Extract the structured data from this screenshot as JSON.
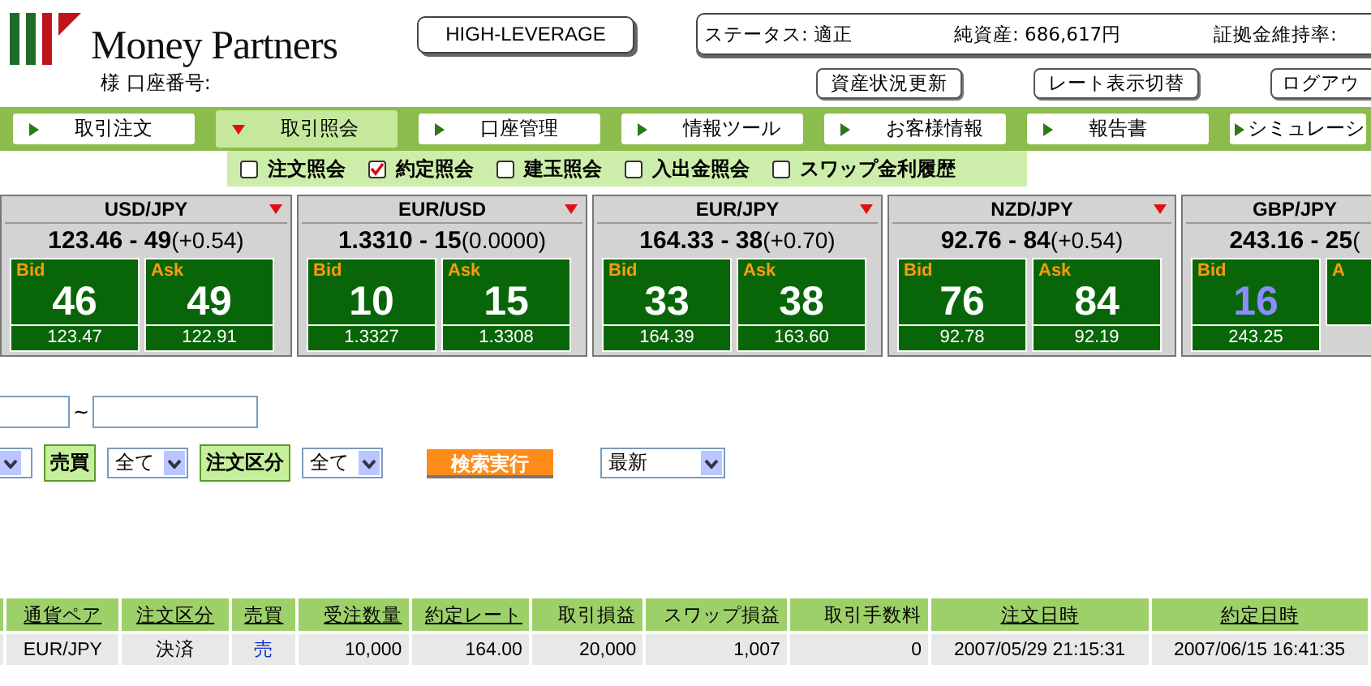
{
  "logo": {
    "name": "Money Partners"
  },
  "account": {
    "label": "様 口座番号:"
  },
  "mode_button": "HIGH-LEVERAGE",
  "status": [
    {
      "text": "ステータス: 適正"
    },
    {
      "text": "純資産: 686,617円"
    },
    {
      "text": "証拠金維持率:"
    }
  ],
  "header_buttons": [
    "資産状況更新",
    "レート表示切替",
    "ログアウ"
  ],
  "tabs": [
    {
      "label": "取引注文",
      "selected": false
    },
    {
      "label": "取引照会",
      "selected": true
    },
    {
      "label": "口座管理",
      "selected": false
    },
    {
      "label": "情報ツール",
      "selected": false
    },
    {
      "label": "お客様情報",
      "selected": false
    },
    {
      "label": "報告書",
      "selected": false
    },
    {
      "label": "シミュレーシ",
      "selected": false
    }
  ],
  "sub_menu": [
    {
      "label": "注文照会",
      "checked": false
    },
    {
      "label": "約定照会",
      "checked": true
    },
    {
      "label": "建玉照会",
      "checked": false
    },
    {
      "label": "入出金照会",
      "checked": false
    },
    {
      "label": "スワップ金利履歴",
      "checked": false
    }
  ],
  "quotes": [
    {
      "pair": "USD/JPY",
      "price": "123.46 - 49",
      "change": "(+0.54)",
      "bid": {
        "label": "Bid",
        "big": "46",
        "sub": "123.47",
        "updated": false
      },
      "ask": {
        "label": "Ask",
        "big": "49",
        "sub": "122.91",
        "updated": false
      }
    },
    {
      "pair": "EUR/USD",
      "price": "1.3310 - 15",
      "change": "(0.0000)",
      "bid": {
        "label": "Bid",
        "big": "10",
        "sub": "1.3327",
        "updated": false
      },
      "ask": {
        "label": "Ask",
        "big": "15",
        "sub": "1.3308",
        "updated": false
      }
    },
    {
      "pair": "EUR/JPY",
      "price": "164.33 - 38",
      "change": "(+0.70)",
      "bid": {
        "label": "Bid",
        "big": "33",
        "sub": "164.39",
        "updated": false
      },
      "ask": {
        "label": "Ask",
        "big": "38",
        "sub": "163.60",
        "updated": false
      }
    },
    {
      "pair": "NZD/JPY",
      "price": "92.76 - 84",
      "change": "(+0.54)",
      "bid": {
        "label": "Bid",
        "big": "76",
        "sub": "92.78",
        "updated": false
      },
      "ask": {
        "label": "Ask",
        "big": "84",
        "sub": "92.19",
        "updated": false
      }
    },
    {
      "pair": "GBP/JPY",
      "price": "243.16 - 25",
      "change": "(",
      "bid": {
        "label": "Bid",
        "big": "16",
        "sub": "243.25",
        "updated": true
      },
      "ask": {
        "label": "A"
      }
    }
  ],
  "filters": {
    "date_separator": "~",
    "side_label": "売買",
    "side_value": "全て",
    "type_label": "注文区分",
    "type_value": "全て",
    "search_button": "検索実行",
    "order_value": "最新"
  },
  "table": {
    "columns": [
      {
        "label": "通貨ペア",
        "link": true,
        "kind": "text"
      },
      {
        "label": "注文区分",
        "link": true,
        "kind": "text"
      },
      {
        "label": "売買",
        "link": true,
        "kind": "text"
      },
      {
        "label": "受注数量",
        "link": true,
        "kind": "number"
      },
      {
        "label": "約定レート",
        "link": true,
        "kind": "number"
      },
      {
        "label": "取引損益",
        "link": false,
        "kind": "number"
      },
      {
        "label": "スワップ損益",
        "link": false,
        "kind": "number"
      },
      {
        "label": "取引手数料",
        "link": false,
        "kind": "number"
      },
      {
        "label": "注文日時",
        "link": true,
        "kind": "text"
      },
      {
        "label": "約定日時",
        "link": true,
        "kind": "text"
      }
    ],
    "rows": [
      {
        "cells": [
          {
            "text": "EUR/JPY",
            "link": false
          },
          {
            "text": "決済",
            "link": false
          },
          {
            "text": "売",
            "link": true
          },
          {
            "text": "10,000",
            "link": false
          },
          {
            "text": "164.00",
            "link": false
          },
          {
            "text": "20,000",
            "link": false
          },
          {
            "text": "1,007",
            "link": false
          },
          {
            "text": "0",
            "link": false
          },
          {
            "text": "2007/05/29 21:15:31",
            "link": false
          },
          {
            "text": "2007/06/15 16:41:35",
            "link": false
          }
        ]
      }
    ]
  }
}
